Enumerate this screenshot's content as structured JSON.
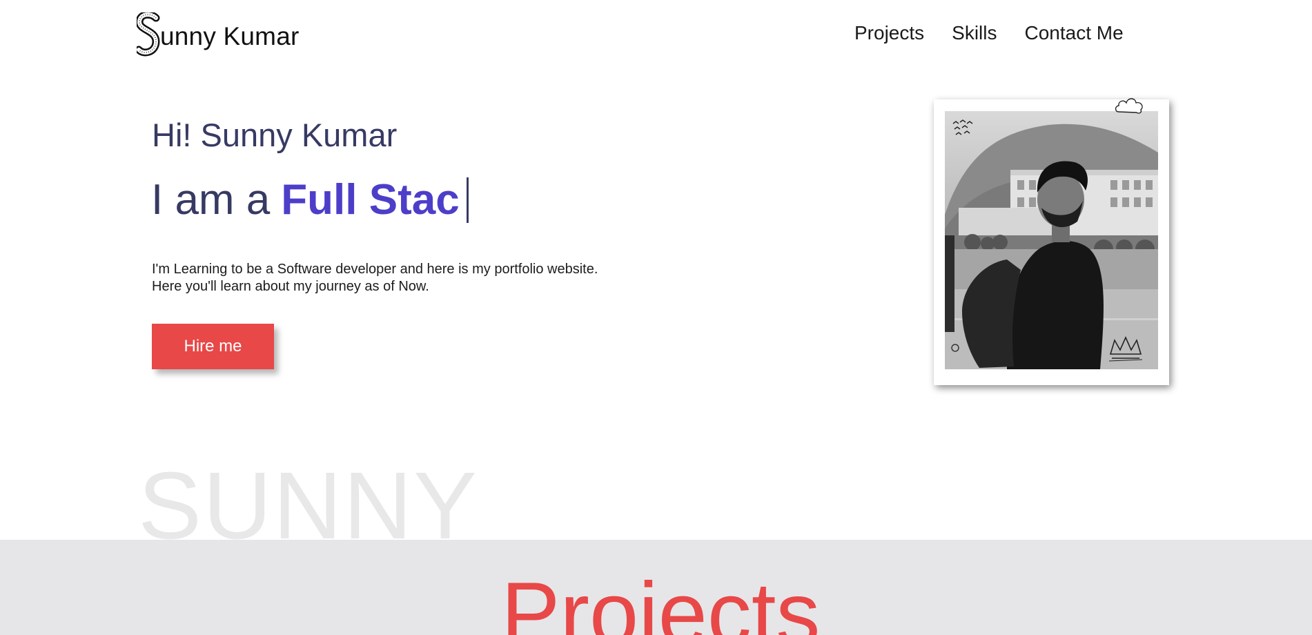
{
  "header": {
    "logo_text": "unny Kumar",
    "logo_icon": "s-monogram-icon",
    "nav": [
      {
        "label": "Projects"
      },
      {
        "label": "Skills"
      },
      {
        "label": "Contact Me"
      }
    ]
  },
  "hero": {
    "greeting": "Hi! Sunny Kumar",
    "role_prefix": "I am a",
    "role_word": "Full Stac",
    "intro_lines": [
      "I'm Learning to be a Software developer and here is my portfolio website.",
      "Here you'll learn about my journey as of Now."
    ],
    "hire_button": "Hire me"
  },
  "photo": {
    "doodles": [
      "birds-doodle-icon",
      "cloud-doodle-icon",
      "crown-doodle-icon",
      "circle-doodle-icon"
    ]
  },
  "watermark": "SUNNY",
  "projects": {
    "title": "Projects"
  },
  "colors": {
    "accent": "#e84848",
    "heading": "#363a63",
    "highlight": "#4d3ec9",
    "band": "#e6e6e8"
  }
}
